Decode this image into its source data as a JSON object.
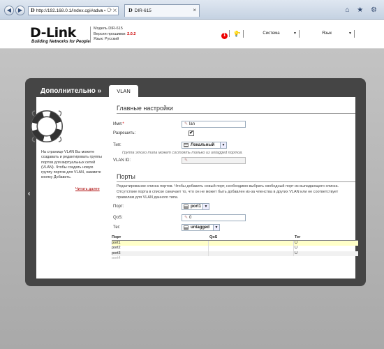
{
  "browser": {
    "address": "http://192.168.0.1/index.cgi#adva",
    "address_badge": "D",
    "tab_title": "DIR-615",
    "tab_badge": "D",
    "tab_close": "×",
    "back_glyph": "◀",
    "forward_glyph": "▶",
    "address_tools": "⌕ ▾ ⟳ ✕",
    "window_icons": "⌂ ★ ⚙"
  },
  "header": {
    "logo": "D-Link",
    "tagline": "Building Networks for People",
    "model_line": "Модель DIR-615",
    "firmware_label": "Версия прошивки:",
    "firmware_value": "2.0.2",
    "language_line": "Язык: Русский",
    "alert_count": "1",
    "menu": [
      {
        "label": "Система"
      },
      {
        "label": "Язык"
      }
    ]
  },
  "panel": {
    "title": "Дополнительно  »",
    "tab_label": "VLAN",
    "nav_arrow": "‹"
  },
  "help": {
    "text": "На странице VLAN Вы можете создавать и редактировать группы портов для виртуальных сетей (VLAN). Чтобы создать новую группу портов для VLAN, нажмите кнопку Добавить.",
    "more_link": "Читать далее"
  },
  "main_settings": {
    "title": "Главные настройки",
    "name_label": "Имя:",
    "name_required": "*",
    "name_value": "lan",
    "enable_label": "Разрешить:",
    "enable_checked": "✔",
    "type_label": "Тип:",
    "type_value": "Локальный",
    "type_hint": "Группа этого типа может состоять только из untagged портов.",
    "vlanid_label": "VLAN ID:",
    "vlanid_value": ""
  },
  "ports": {
    "title": "Порты",
    "description": "Редактирование списка портов. Чтобы добавить новый порт, необходимо выбрать свободный порт из выпадающего списка. Отсутствие порта в списке означает то, что он не может быть добавлен из-за членства в других VLAN или не соответствует правилам для VLAN данного типа.",
    "port_label": "Порт:",
    "port_value": "port1",
    "qos_label": "QoS:",
    "qos_value": "0",
    "tag_label": "Тег:",
    "tag_value": "untagged",
    "table": {
      "headers": [
        "Порт",
        "QoS",
        "Тег"
      ],
      "rows": [
        {
          "port": "port1",
          "qos": "",
          "tag": "U"
        },
        {
          "port": "port2",
          "qos": "",
          "tag": "U"
        },
        {
          "port": "port3",
          "qos": "",
          "tag": "U"
        },
        {
          "port": "port4",
          "qos": "",
          "tag": ""
        }
      ]
    }
  }
}
